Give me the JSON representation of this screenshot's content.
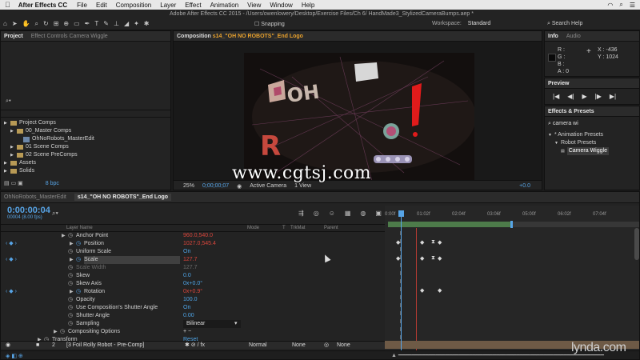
{
  "menubar": {
    "apple_icon": "apple-icon",
    "app_name": "After Effects CC",
    "items": [
      "File",
      "Edit",
      "Composition",
      "Layer",
      "Effect",
      "Animation",
      "View",
      "Window",
      "Help"
    ]
  },
  "toolbar": {
    "document_title": "Adobe After Effects CC 2015 - /Users/owenlowery/Desktop/Exercise Files/Ch 6/ HandMade3_StylizedCameraBumps.aep *",
    "snapping_label": "Snapping",
    "workspace_label": "Workspace:",
    "workspace_value": "Standard",
    "search_help": "Search Help"
  },
  "project_panel": {
    "tabs": [
      "Project",
      "Effect Controls Camera Wiggle"
    ],
    "tree": [
      {
        "label": "Project Comps",
        "type": "folder",
        "indent": 0
      },
      {
        "label": "00_Master Comps",
        "type": "folder",
        "indent": 1
      },
      {
        "label": "OhNoRobots_MasterEdit",
        "type": "comp",
        "indent": 2
      },
      {
        "label": "01 Scene Comps",
        "type": "folder",
        "indent": 1
      },
      {
        "label": "02 Scene PreComps",
        "type": "folder",
        "indent": 1
      },
      {
        "label": "Assets",
        "type": "folder",
        "indent": 0
      },
      {
        "label": "Solids",
        "type": "folder",
        "indent": 0
      }
    ],
    "bpc": "8 bpc"
  },
  "comp_panel": {
    "tab_prefix": "Composition",
    "comp_name": "s14_\"OH NO ROBOTS\"_End Logo",
    "zoom": "25%",
    "time": "0;00;00;07",
    "view": "Active Camera",
    "views": "1 View",
    "exposure": "+0.0"
  },
  "watermark": "www.cgtsj.com",
  "info_panel": {
    "tabs": [
      "Info",
      "Audio"
    ],
    "rgb": [
      "R :",
      "G :",
      "B :",
      "A : 0"
    ],
    "coords": [
      "X : -436",
      "Y : 1024"
    ]
  },
  "preview_panel": {
    "title": "Preview",
    "controls": [
      "|◀",
      "◀|",
      "▶",
      "|▶",
      "▶|"
    ]
  },
  "effects_panel": {
    "title": "Effects & Presets",
    "search_value": "camera wi",
    "items": [
      {
        "label": "* Animation Presets",
        "indent": 0,
        "selected": false
      },
      {
        "label": "Robot Presets",
        "indent": 1,
        "selected": false
      },
      {
        "label": "Camera Wiggle",
        "indent": 2,
        "selected": true
      }
    ]
  },
  "timeline": {
    "tabs": [
      "OhNoRobots_MasterEdit",
      "s14_\"OH NO ROBOTS\"_End Logo"
    ],
    "timecode": "0:00:00:04",
    "fps": "00004 (8.00 fps)",
    "columns": {
      "layer_name": "Layer Name",
      "mode": "Mode",
      "t": "T",
      "trkmat": "TrkMat",
      "parent": "Parent"
    },
    "ruler": [
      "0:00f",
      "01:02f",
      "02:04f",
      "03:06f",
      "05:00f",
      "06:02f",
      "07:04f"
    ],
    "properties": [
      {
        "name": "Anchor Point",
        "value": "960.0,540.0",
        "color": "red",
        "indent": 94,
        "keyed": false,
        "twirl": true
      },
      {
        "name": "Position",
        "value": "1027.0,545.4",
        "color": "red",
        "indent": 104,
        "keyed": true,
        "twirl": true
      },
      {
        "name": "Uniform Scale",
        "value": "On",
        "color": "blue",
        "indent": 94,
        "keyed": false,
        "twirl": false
      },
      {
        "name": "Scale",
        "value": "127.7",
        "color": "red",
        "indent": 104,
        "keyed": true,
        "twirl": true,
        "highlight": true
      },
      {
        "name": "Scale Width",
        "value": "127.7",
        "color": "dim",
        "indent": 94,
        "keyed": false,
        "twirl": false
      },
      {
        "name": "Skew",
        "value": "0.0",
        "color": "blue",
        "indent": 94,
        "keyed": false,
        "twirl": false
      },
      {
        "name": "Skew Axis",
        "value": "0x+0.0°",
        "color": "blue",
        "indent": 94,
        "keyed": false,
        "twirl": false
      },
      {
        "name": "Rotation",
        "value": "0x+0.9°",
        "color": "red",
        "indent": 104,
        "keyed": true,
        "twirl": true
      },
      {
        "name": "Opacity",
        "value": "100.0",
        "color": "blue",
        "indent": 94,
        "keyed": false,
        "twirl": false
      },
      {
        "name": "Use Composition's Shutter Angle",
        "value": "On",
        "color": "blue",
        "indent": 94,
        "keyed": false,
        "twirl": false
      },
      {
        "name": "Shutter Angle",
        "value": "0.00",
        "color": "blue",
        "indent": 94,
        "keyed": false,
        "twirl": false
      },
      {
        "name": "Sampling",
        "value": "Bilinear",
        "color": "plain",
        "indent": 94,
        "keyed": false,
        "twirl": false,
        "dropdown": true
      },
      {
        "name": "Compositing Options",
        "value": "+ −",
        "color": "plain",
        "indent": 84,
        "keyed": false,
        "twirl": true
      },
      {
        "name": "Transform",
        "value": "Reset",
        "color": "blue",
        "indent": 64,
        "keyed": false,
        "twirl": true
      }
    ],
    "layer": {
      "number": "2",
      "name": "[3 Foil Rolly Robot - Pre-Comp]",
      "mode": "Normal",
      "trkmat": "None",
      "parent": "None"
    }
  },
  "branding": "lynda.com"
}
